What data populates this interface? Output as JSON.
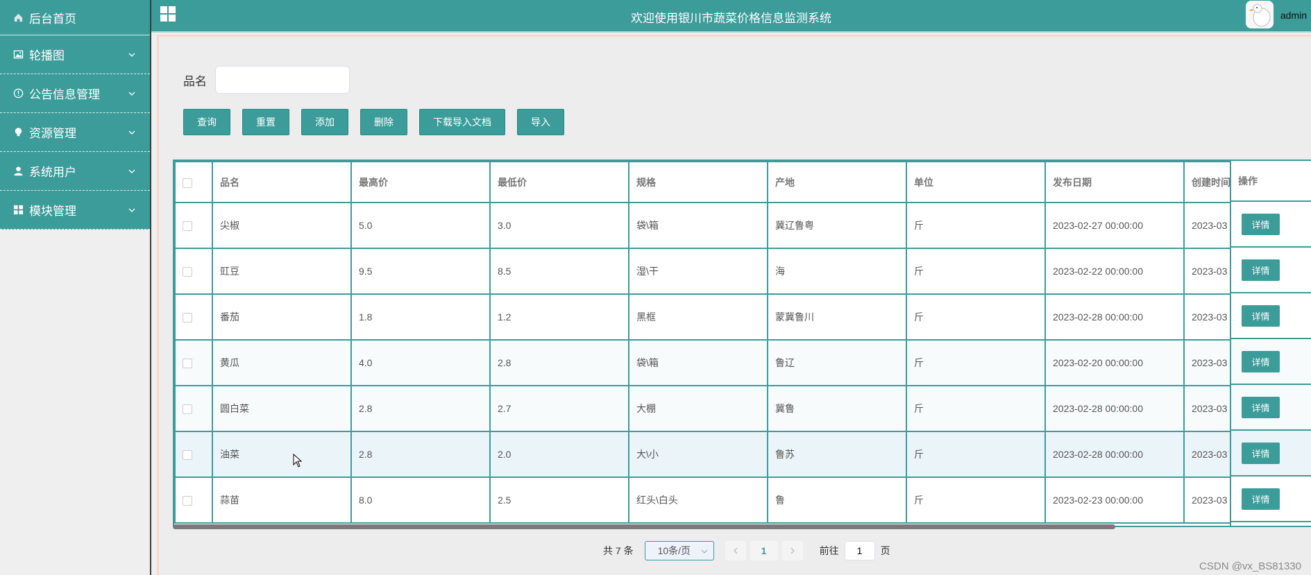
{
  "sidebar": {
    "items": [
      {
        "label": "后台首页",
        "icon": "home-icon"
      },
      {
        "label": "轮播图",
        "icon": "image-icon"
      },
      {
        "label": "公告信息管理",
        "icon": "info-circle-icon"
      },
      {
        "label": "资源管理",
        "icon": "bulb-icon"
      },
      {
        "label": "系统用户",
        "icon": "user-icon"
      },
      {
        "label": "模块管理",
        "icon": "grid-icon"
      }
    ]
  },
  "header": {
    "title": "欢迎使用银川市蔬菜价格信息监测系统",
    "username": "admin"
  },
  "search": {
    "label": "品名",
    "value": ""
  },
  "toolbar": {
    "query": "查询",
    "reset": "重置",
    "add": "添加",
    "delete": "删除",
    "download": "下载导入文档",
    "import": "导入"
  },
  "table": {
    "columns": [
      "品名",
      "最高价",
      "最低价",
      "规格",
      "产地",
      "单位",
      "发布日期",
      "创建时间",
      "操作"
    ],
    "rows": [
      {
        "name": "尖椒",
        "max": "5.0",
        "min": "3.0",
        "spec": "袋\\箱",
        "origin": "冀辽鲁粤",
        "unit": "斤",
        "date": "2023-02-27 00:00:00",
        "created": "2023-03"
      },
      {
        "name": "豇豆",
        "max": "9.5",
        "min": "8.5",
        "spec": "湿\\干",
        "origin": "海",
        "unit": "斤",
        "date": "2023-02-22 00:00:00",
        "created": "2023-03"
      },
      {
        "name": "番茄",
        "max": "1.8",
        "min": "1.2",
        "spec": "黑框",
        "origin": "蒙冀鲁川",
        "unit": "斤",
        "date": "2023-02-28 00:00:00",
        "created": "2023-03"
      },
      {
        "name": "黄瓜",
        "max": "4.0",
        "min": "2.8",
        "spec": "袋\\箱",
        "origin": "鲁辽",
        "unit": "斤",
        "date": "2023-02-20 00:00:00",
        "created": "2023-03"
      },
      {
        "name": "圆白菜",
        "max": "2.8",
        "min": "2.7",
        "spec": "大棚",
        "origin": "冀鲁",
        "unit": "斤",
        "date": "2023-02-28 00:00:00",
        "created": "2023-03"
      },
      {
        "name": "油菜",
        "max": "2.8",
        "min": "2.0",
        "spec": "大\\小",
        "origin": "鲁苏",
        "unit": "斤",
        "date": "2023-02-28 00:00:00",
        "created": "2023-03"
      },
      {
        "name": "蒜苗",
        "max": "8.0",
        "min": "2.5",
        "spec": "红头\\白头",
        "origin": "鲁",
        "unit": "斤",
        "date": "2023-02-23 00:00:00",
        "created": "2023-03"
      }
    ],
    "detail_label": "详情"
  },
  "pagination": {
    "total_text": "共 7 条",
    "page_size": "10条/页",
    "current_page": "1",
    "goto_label": "前往",
    "goto_value": "1",
    "page_suffix": "页"
  },
  "watermark": "CSDN @vx_BS81330",
  "colors": {
    "primary": "#3b9c9a",
    "background": "#efefef"
  }
}
